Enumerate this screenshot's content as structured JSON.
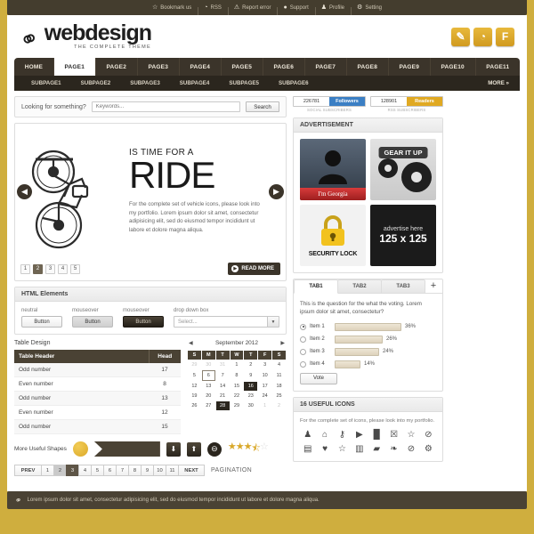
{
  "topbar": {
    "items": [
      {
        "icon": "star-icon",
        "glyph": "☆",
        "label": "Bookmark us"
      },
      {
        "icon": "rss-icon",
        "glyph": "◔",
        "label": "RSS"
      },
      {
        "icon": "warning-icon",
        "glyph": "⚠",
        "label": "Report error"
      },
      {
        "icon": "chat-icon",
        "glyph": "●",
        "label": "Support"
      },
      {
        "icon": "user-icon",
        "glyph": "♟",
        "label": "Profile"
      },
      {
        "icon": "gear-icon",
        "glyph": "⚙",
        "label": "Setting"
      }
    ]
  },
  "header": {
    "logo_mark": "⚭",
    "logo_main": "webdesign",
    "logo_sub": "THE COMPLETE THEME",
    "social": [
      {
        "name": "rss-feed-icon",
        "glyph": "✎"
      },
      {
        "name": "rss-icon",
        "glyph": "◔"
      },
      {
        "name": "facebook-icon",
        "glyph": "F"
      }
    ]
  },
  "nav": {
    "items": [
      {
        "label": "HOME",
        "active": false
      },
      {
        "label": "PAGE1",
        "active": true
      },
      {
        "label": "PAGE2",
        "active": false
      },
      {
        "label": "PAGE3",
        "active": false
      },
      {
        "label": "PAGE4",
        "active": false
      },
      {
        "label": "PAGE5",
        "active": false
      },
      {
        "label": "PAGE6",
        "active": false
      },
      {
        "label": "PAGE7",
        "active": false
      },
      {
        "label": "PAGE8",
        "active": false
      },
      {
        "label": "PAGE9",
        "active": false
      },
      {
        "label": "PAGE10",
        "active": false
      },
      {
        "label": "PAGE11",
        "active": false
      }
    ],
    "subitems": [
      {
        "label": "SUBPAGE1"
      },
      {
        "label": "SUBPAGE2"
      },
      {
        "label": "SUBPAGE3"
      },
      {
        "label": "SUBPAGE4"
      },
      {
        "label": "SUBPAGE5"
      },
      {
        "label": "SUBPAGE6"
      }
    ],
    "more_label": "MORE »"
  },
  "search": {
    "label": "Looking for something?",
    "placeholder": "Keywords...",
    "button": "Search"
  },
  "slider": {
    "kicker": "IS TIME FOR A",
    "title": "RIDE",
    "desc": "For the complete set of vehicle icons, please look into my portfolio. Lorem ipsum dolor sit amet, consectetur adipisicing elit, sed do eiusmod tempor incididunt ut labore et dolore magna aliqua.",
    "prev_glyph": "◀",
    "next_glyph": "▶",
    "dots": [
      "1",
      "2",
      "3",
      "4",
      "5"
    ],
    "active_dot": "2",
    "readmore": "READ MORE",
    "readmore_glyph": "▶"
  },
  "html_elements": {
    "title": "HTML Elements",
    "fields": [
      {
        "label": "neutral",
        "button": "Button",
        "state": "neutral"
      },
      {
        "label": "mouseover",
        "button": "Button",
        "state": "hover"
      },
      {
        "label": "mouseover",
        "button": "Button",
        "state": "dark"
      }
    ],
    "dropdown_label": "drop down box",
    "dropdown_value": "Select...",
    "dropdown_glyph": "▼"
  },
  "table": {
    "section_label": "Table Design",
    "headers": [
      "Table Header",
      "Head"
    ],
    "rows": [
      {
        "label": "Odd number",
        "value": "17"
      },
      {
        "label": "Even number",
        "value": "8"
      },
      {
        "label": "Odd number",
        "value": "13"
      },
      {
        "label": "Even number",
        "value": "12"
      },
      {
        "label": "Odd number",
        "value": "15"
      }
    ]
  },
  "calendar": {
    "month": "September 2012",
    "prev_glyph": "◀",
    "next_glyph": "▶",
    "daynames": [
      "S",
      "M",
      "T",
      "W",
      "T",
      "F",
      "S"
    ],
    "weeks": [
      [
        {
          "d": "29",
          "mute": true
        },
        {
          "d": "30",
          "mute": true
        },
        {
          "d": "31",
          "mute": true
        },
        {
          "d": "1"
        },
        {
          "d": "2"
        },
        {
          "d": "3"
        },
        {
          "d": "4"
        }
      ],
      [
        {
          "d": "5"
        },
        {
          "d": "6",
          "today": true
        },
        {
          "d": "7"
        },
        {
          "d": "8"
        },
        {
          "d": "9"
        },
        {
          "d": "10"
        },
        {
          "d": "11"
        }
      ],
      [
        {
          "d": "12"
        },
        {
          "d": "13"
        },
        {
          "d": "14"
        },
        {
          "d": "15"
        },
        {
          "d": "16",
          "sel": true
        },
        {
          "d": "17"
        },
        {
          "d": "18"
        }
      ],
      [
        {
          "d": "19"
        },
        {
          "d": "20"
        },
        {
          "d": "21"
        },
        {
          "d": "22"
        },
        {
          "d": "23"
        },
        {
          "d": "24"
        },
        {
          "d": "25"
        }
      ],
      [
        {
          "d": "26"
        },
        {
          "d": "27"
        },
        {
          "d": "28",
          "sel": true
        },
        {
          "d": "29"
        },
        {
          "d": "30"
        },
        {
          "d": "1",
          "mute": true
        },
        {
          "d": "2",
          "mute": true
        }
      ]
    ]
  },
  "shapes": {
    "label": "More Useful Shapes",
    "banner_glyph": "»",
    "down_glyph": "⬇",
    "up_glyph": "⬆",
    "minus_glyph": "⊖",
    "stars": [
      "★",
      "★",
      "★",
      "⯪",
      "☆"
    ],
    "rating": "3.5"
  },
  "pagination": {
    "prev": "PREV",
    "next": "NEXT",
    "pages": [
      "1",
      "2",
      "3",
      "4",
      "5",
      "6",
      "7",
      "8",
      "9",
      "10",
      "11"
    ],
    "current": "3",
    "hover": "2",
    "note": "PAGINATION"
  },
  "sidebar": {
    "stats": [
      {
        "count": "226781",
        "tag": "Followers",
        "sub": "SOCIAL SUBSCRIBERS",
        "color": "#3b7fc4"
      },
      {
        "count": "128901",
        "tag": "Readers",
        "sub": "RSS SUBSCRIBERS",
        "color": "#e0a922"
      }
    ],
    "ads_title": "ADVERTISEMENT",
    "ads": [
      {
        "name": "ad-im-georgia",
        "caption": "I'm Georgia"
      },
      {
        "name": "ad-gear-it-up",
        "caption": "GEAR IT UP"
      },
      {
        "name": "ad-security-lock",
        "caption": "SECURITY LOCK"
      },
      {
        "name": "ad-placeholder",
        "line1": "advertise here",
        "line2": "125 x 125"
      }
    ],
    "tabs": [
      {
        "label": "TAB1",
        "active": true
      },
      {
        "label": "TAB2",
        "active": false
      },
      {
        "label": "TAB3",
        "active": false
      }
    ],
    "tab_add_glyph": "+",
    "vote": {
      "question": "This is the question for the what the voting. Lorem ipsum dolor sit amet, consectetur?",
      "options": [
        {
          "label": "Item 1",
          "pct": "36%",
          "value": 36,
          "selected": true
        },
        {
          "label": "Item 2",
          "pct": "26%",
          "value": 26,
          "selected": false
        },
        {
          "label": "Item 3",
          "pct": "24%",
          "value": 24,
          "selected": false
        },
        {
          "label": "Item 4",
          "pct": "14%",
          "value": 14,
          "selected": false
        }
      ],
      "button": "Vote"
    },
    "icons_title": "16 USEFUL ICONS",
    "icons_desc": "For the complete set of icons, please look into my portfolio.",
    "icons": [
      {
        "name": "user-icon",
        "glyph": "♟"
      },
      {
        "name": "home-icon",
        "glyph": "⌂"
      },
      {
        "name": "key-icon",
        "glyph": "⚷"
      },
      {
        "name": "video-camera-icon",
        "glyph": "▶"
      },
      {
        "name": "chart-icon",
        "glyph": "█"
      },
      {
        "name": "trash-icon",
        "glyph": "☒"
      },
      {
        "name": "star-outline-icon",
        "glyph": "☆"
      },
      {
        "name": "no-entry-icon",
        "glyph": "⊘"
      },
      {
        "name": "document-icon",
        "glyph": "▤"
      },
      {
        "name": "heart-icon",
        "glyph": "♥"
      },
      {
        "name": "star-icon",
        "glyph": "☆"
      },
      {
        "name": "book-icon",
        "glyph": "▥"
      },
      {
        "name": "tag-icon",
        "glyph": "▰"
      },
      {
        "name": "bird-icon",
        "glyph": "❧"
      },
      {
        "name": "block-icon",
        "glyph": "⊘"
      },
      {
        "name": "gear-icon",
        "glyph": "⚙"
      }
    ]
  },
  "footer": {
    "icon": "link-icon",
    "glyph": "⚭",
    "text": "Lorem ipsum dolor sit amet, consectetur adipisicing elit, sed do eiusmod tempor incididunt ut labore et dolore magna aliqua."
  }
}
